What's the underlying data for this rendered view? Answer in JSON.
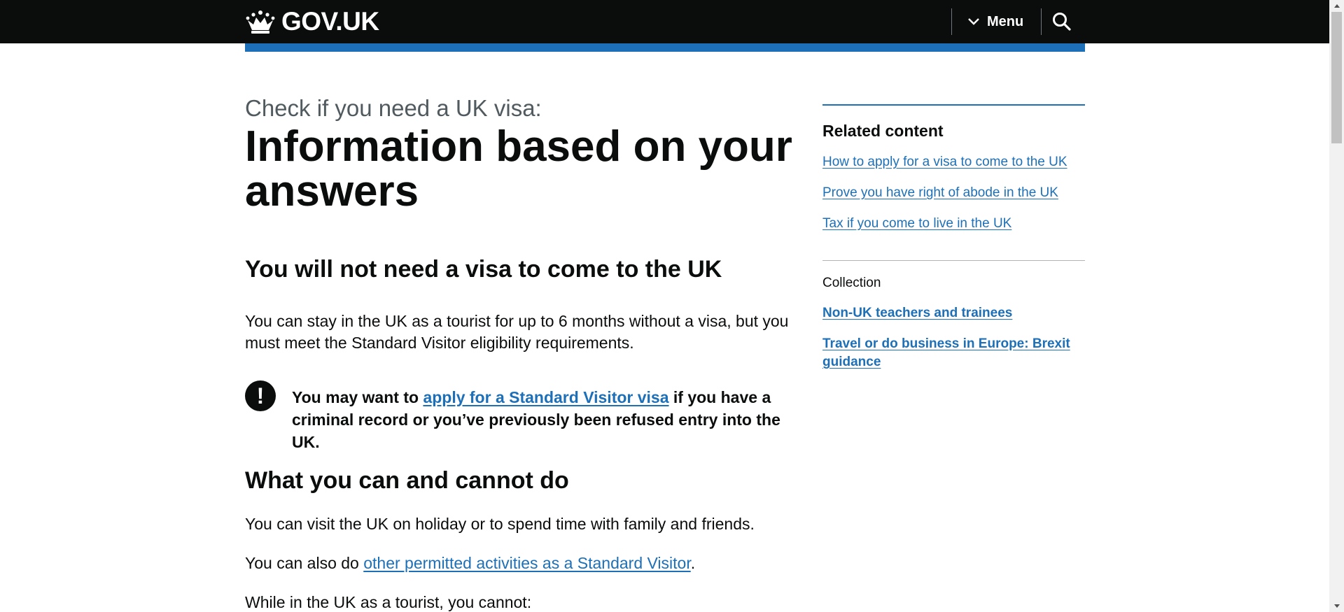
{
  "header": {
    "logo_text": "GOV.UK",
    "menu_label": "Menu",
    "brand_bar_color": "#1d70b8",
    "background_color": "#0b0c0c"
  },
  "main": {
    "caption": "Check if you need a UK visa:",
    "title": "Information based on your answers",
    "result_heading": "You will not need a visa to come to the UK",
    "intro_paragraph": "You can stay in the UK as a tourist for up to 6 months without a visa, but you must meet the Standard Visitor eligibility requirements.",
    "warning": {
      "icon": "!",
      "prefix": "You may want to ",
      "link_text": "apply for a Standard Visitor visa",
      "suffix": " if you have a criminal record or you’ve previously been refused entry into the UK."
    },
    "section_heading": "What you can and cannot do",
    "visit_paragraph": "You can visit the UK on holiday or to spend time with family and friends.",
    "also_prefix": "You can also do ",
    "also_link": "other permitted activities as a Standard Visitor",
    "also_suffix": ".",
    "cannot_intro": "While in the UK as a tourist, you cannot:"
  },
  "sidebar": {
    "related_heading": "Related content",
    "related_links": [
      "How to apply for a visa to come to the UK",
      "Prove you have right of abode in the UK",
      "Tax if you come to live in the UK"
    ],
    "collection_label": "Collection",
    "collection_links": [
      "Non-UK teachers and trainees",
      "Travel or do business in Europe: Brexit guidance"
    ]
  },
  "icons": {
    "logo": "crown-icon",
    "menu": "chevron-down-icon",
    "search": "search-icon",
    "warning": "exclamation-icon"
  },
  "colors": {
    "link": "#1d70b8",
    "text": "#0b0c0c",
    "secondary_text": "#505a5f"
  }
}
